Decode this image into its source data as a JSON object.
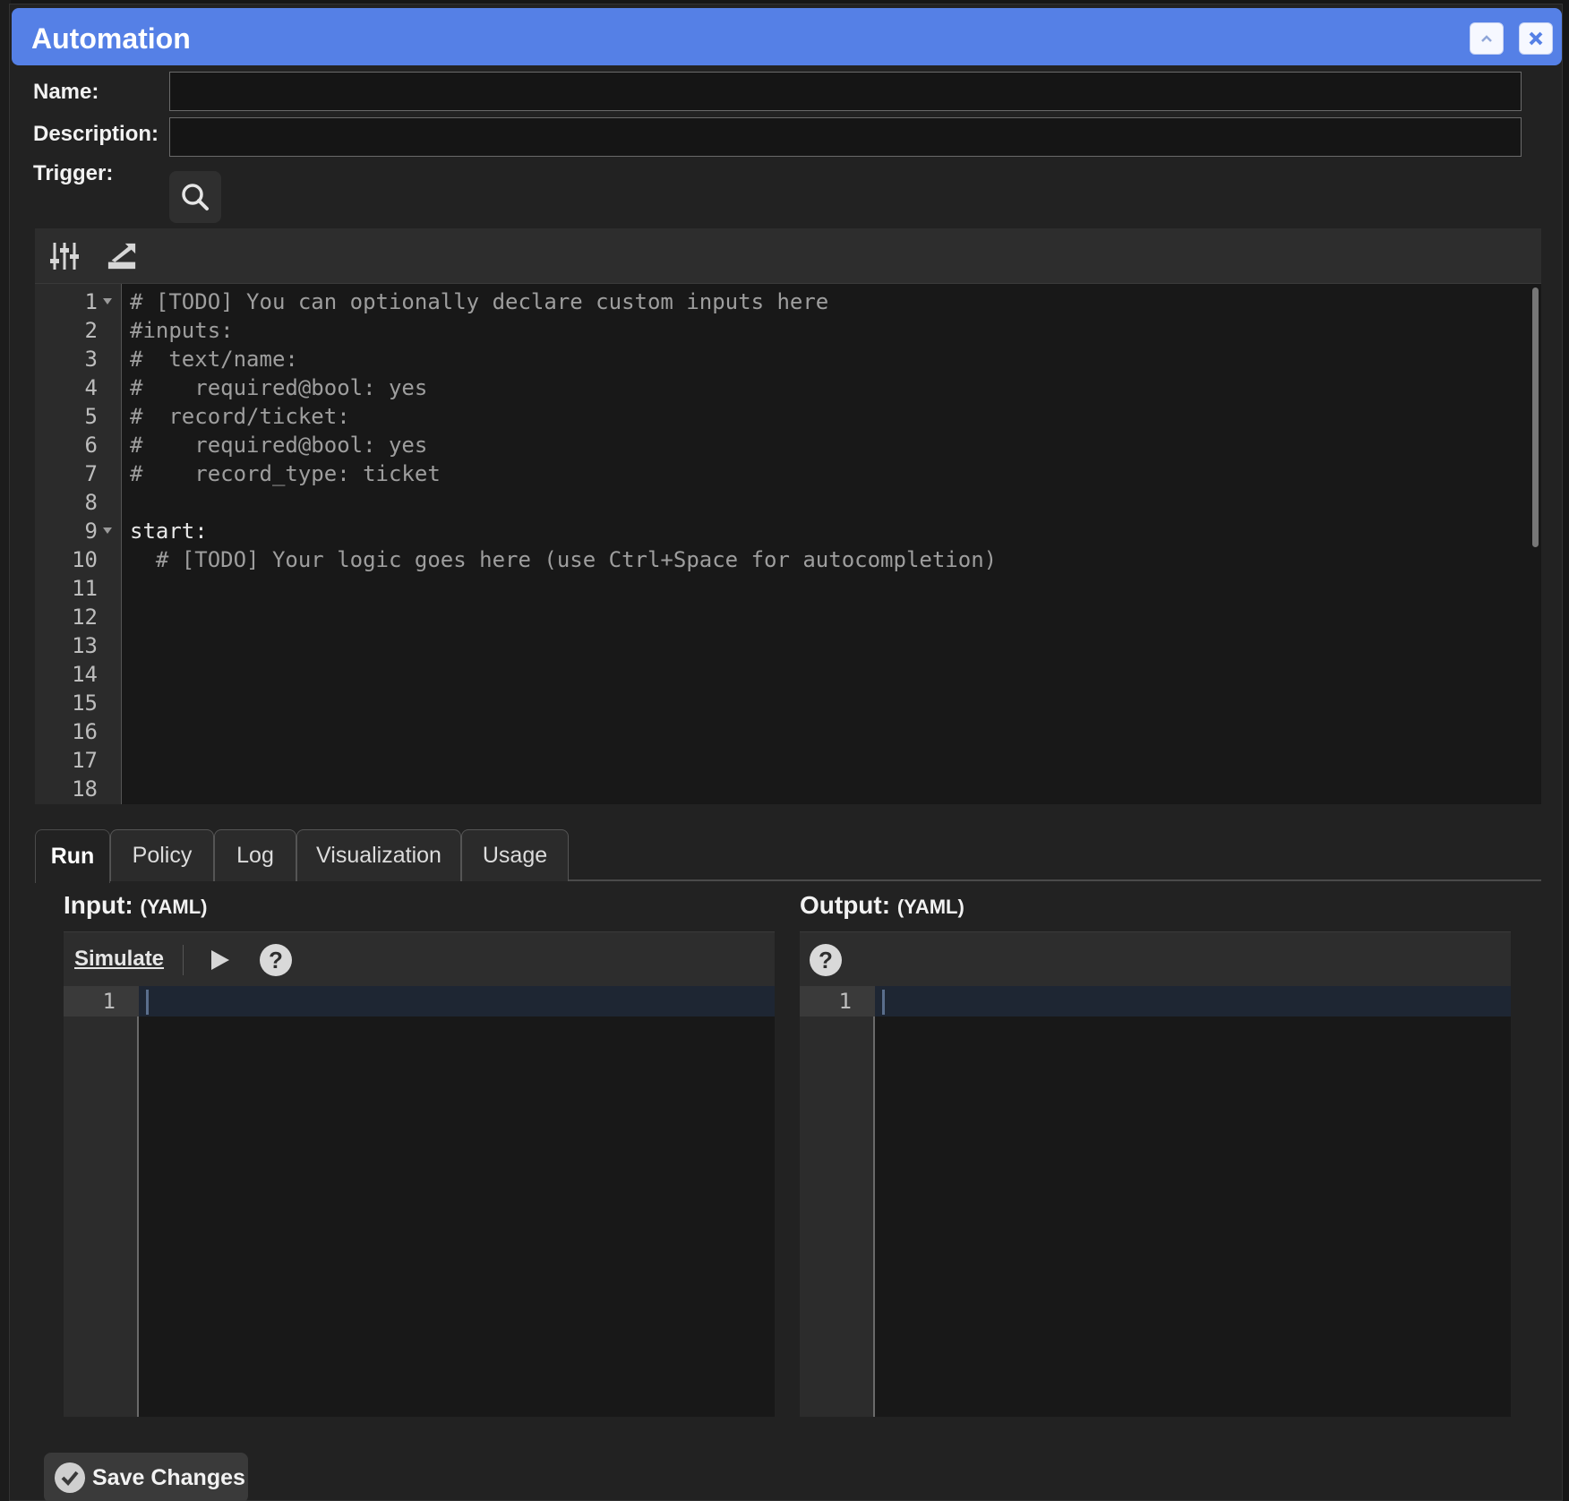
{
  "window": {
    "title": "Automation"
  },
  "form": {
    "name_label": "Name:",
    "name_value": "",
    "description_label": "Description:",
    "description_value": "",
    "trigger_label": "Trigger:"
  },
  "editor": {
    "toolbar_icons": [
      "sliders-icon",
      "export-icon"
    ],
    "lines": [
      {
        "num": "1",
        "text": "# [TODO] You can optionally declare custom inputs here",
        "fold": true,
        "kind": "comment"
      },
      {
        "num": "2",
        "text": "#inputs:",
        "fold": false,
        "kind": "comment"
      },
      {
        "num": "3",
        "text": "#  text/name:",
        "fold": false,
        "kind": "comment"
      },
      {
        "num": "4",
        "text": "#    required@bool: yes",
        "fold": false,
        "kind": "comment"
      },
      {
        "num": "5",
        "text": "#  record/ticket:",
        "fold": false,
        "kind": "comment"
      },
      {
        "num": "6",
        "text": "#    required@bool: yes",
        "fold": false,
        "kind": "comment"
      },
      {
        "num": "7",
        "text": "#    record_type: ticket",
        "fold": false,
        "kind": "comment"
      },
      {
        "num": "8",
        "text": "",
        "fold": false,
        "kind": "comment"
      },
      {
        "num": "9",
        "text": "start:",
        "fold": true,
        "kind": "key"
      },
      {
        "num": "10",
        "text": "  # [TODO] Your logic goes here (use Ctrl+Space for autocompletion)",
        "fold": false,
        "kind": "comment"
      },
      {
        "num": "11",
        "text": "",
        "fold": false,
        "kind": "comment"
      },
      {
        "num": "12",
        "text": "",
        "fold": false,
        "kind": "comment"
      },
      {
        "num": "13",
        "text": "",
        "fold": false,
        "kind": "comment"
      },
      {
        "num": "14",
        "text": "",
        "fold": false,
        "kind": "comment"
      },
      {
        "num": "15",
        "text": "",
        "fold": false,
        "kind": "comment"
      },
      {
        "num": "16",
        "text": "",
        "fold": false,
        "kind": "comment"
      },
      {
        "num": "17",
        "text": "",
        "fold": false,
        "kind": "comment"
      },
      {
        "num": "18",
        "text": "",
        "fold": false,
        "kind": "comment"
      }
    ]
  },
  "tabs": [
    {
      "label": "Run",
      "active": true
    },
    {
      "label": "Policy",
      "active": false
    },
    {
      "label": "Log",
      "active": false
    },
    {
      "label": "Visualization",
      "active": false
    },
    {
      "label": "Usage",
      "active": false
    }
  ],
  "run": {
    "input_title": "Input:",
    "input_sub": "(YAML)",
    "output_title": "Output:",
    "output_sub": "(YAML)",
    "simulate_label": "Simulate",
    "help_glyph": "?",
    "input_line": "1",
    "output_line": "1"
  },
  "footer": {
    "save_label": "Save Changes"
  },
  "colors": {
    "titlebar": "#5580e6",
    "background": "#222222",
    "editor_bg": "#181818"
  }
}
